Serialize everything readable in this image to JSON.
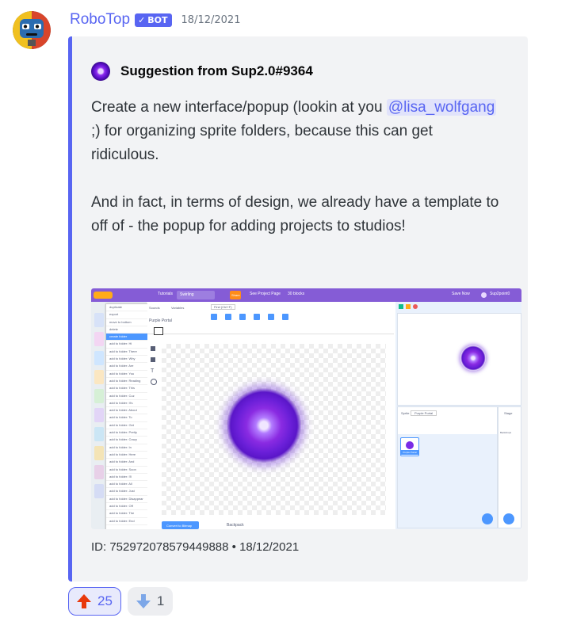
{
  "message": {
    "author": "RoboTop",
    "bot_badge": "BOT",
    "timestamp": "18/12/2021"
  },
  "embed": {
    "author_name": "Suggestion from Sup2.0#9364",
    "description_part1": "Create a new interface/popup (lookin at you ",
    "mention": "@lisa_wolfgang",
    "description_part2": " ;) for organizing sprite folders, because this can get ridiculous.",
    "description_para2": "And in fact, in terms of design, we already have a template to off of - the popup for adding projects to studios!",
    "footer": "ID: 752972078579449888 • 18/12/2021",
    "accent_color": "#5865f2"
  },
  "screenshot": {
    "menu": {
      "tutorials": "Tutorials",
      "project_title": "Swirling",
      "share": "Share",
      "see_project_page": "See Project Page",
      "saved": "30 blocks",
      "save_now": "Save Now",
      "username": "Sup2point0"
    },
    "context_menu": [
      "duplicate",
      "export",
      "move to bottom",
      "delete",
      "create folder",
      "add to folder: Hi",
      "add to folder: There",
      "add to folder: Why",
      "add to folder: Are",
      "add to folder: You",
      "add to folder: Reading",
      "add to folder: This",
      "add to folder: Cuz",
      "add to folder: It's",
      "add to folder: About",
      "add to folder: To",
      "add to folder: Get",
      "add to folder: Pretty",
      "add to folder: Crazy",
      "add to folder: In",
      "add to folder: Here",
      "add to folder: And",
      "add to folder: Soon",
      "add to folder: I'll",
      "add to folder: All",
      "add to folder: Just",
      "add to folder: Disappear",
      "add to folder: Off",
      "add to folder: The",
      "add to folder: End"
    ],
    "selected_menu_item": "create folder",
    "editor_tabs": [
      "Sounds",
      "Variables"
    ],
    "costume_name": "Purple Portal",
    "size_label": "Find (Ctrl+F)",
    "convert_button": "Convert to Bitmap",
    "sprite_label": "Sprite",
    "sprite_name": "Purple Portal",
    "sprite_tile_label": "Purple Portal",
    "stage_label": "Stage",
    "backdrops_label": "Backdrops",
    "backpack_label": "Backpack"
  },
  "reactions": [
    {
      "emoji": "up-arrow",
      "count": "25",
      "active": true
    },
    {
      "emoji": "down-arrow",
      "count": "1",
      "active": false
    }
  ]
}
